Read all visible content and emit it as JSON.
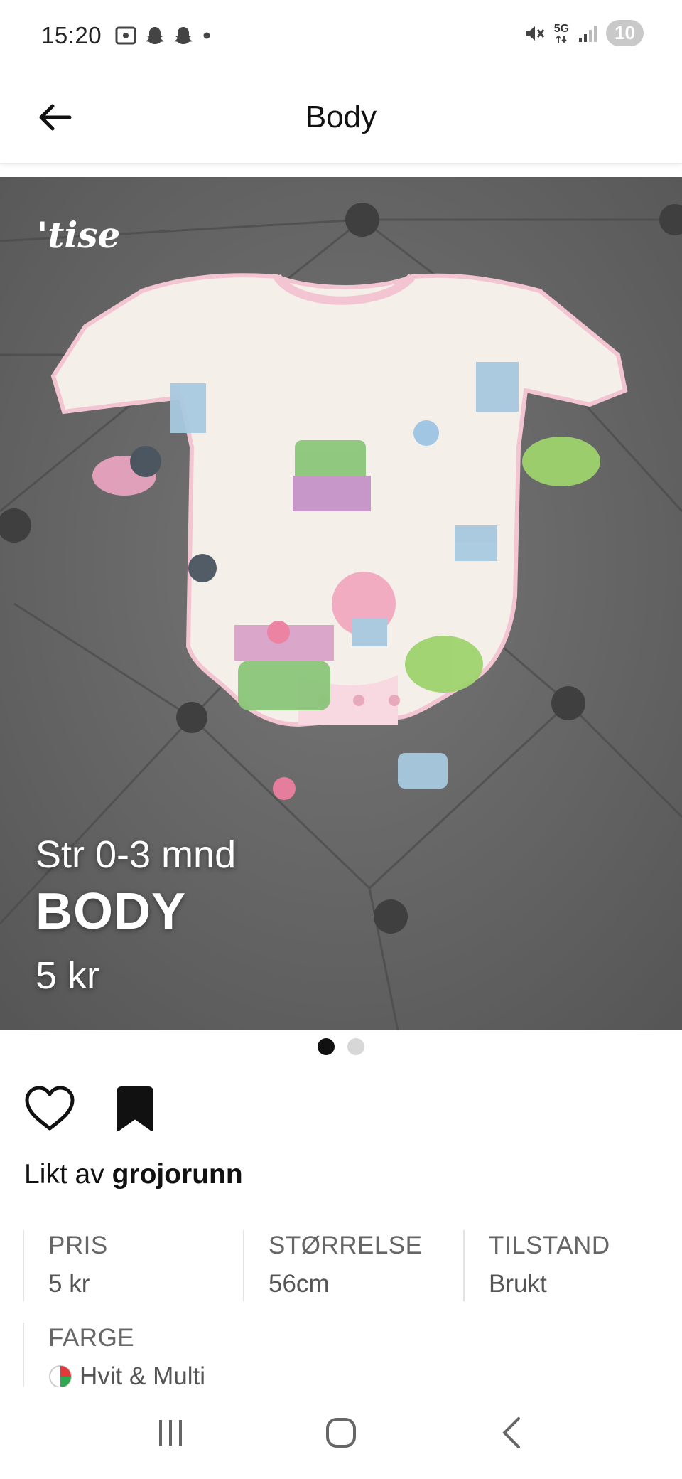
{
  "status_bar": {
    "time": "15:20",
    "network": "5G",
    "notification_count": "10"
  },
  "app_bar": {
    "title": "Body"
  },
  "photo": {
    "watermark": "'tise",
    "size_text": "Str 0-3 mnd",
    "name_text": "BODY",
    "price_text": "5 kr",
    "page_index": 1,
    "page_count": 2
  },
  "actions": {
    "like_icon": "heart-outline-icon",
    "save_icon": "bookmark-filled-icon"
  },
  "likes": {
    "prefix": "Likt av",
    "username": "grojorunn"
  },
  "attributes": [
    {
      "label": "PRIS",
      "value": "5 kr"
    },
    {
      "label": "STØRRELSE",
      "value": "56cm"
    },
    {
      "label": "TILSTAND",
      "value": "Brukt"
    },
    {
      "label": "FARGE",
      "value": "Hvit & Multi"
    }
  ],
  "colors": {
    "background": "#ffffff",
    "cushion": "#6b6b6b",
    "garment": "#f4efe9",
    "trim": "#f3c4d1",
    "active_dot": "#111111",
    "inactive_dot": "#d7d7d7"
  }
}
